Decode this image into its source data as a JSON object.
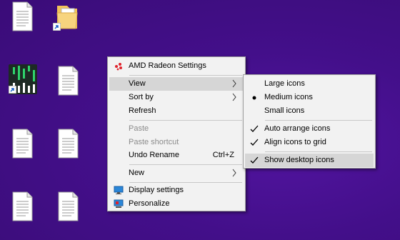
{
  "desktop": {
    "icon_names": [
      "text-file-icon",
      "folder-shortcut-icon",
      "equalizer-app-shortcut-icon",
      "shortcut-arrow-icon"
    ]
  },
  "context_menu": {
    "amd_label": "AMD Radeon Settings",
    "view_label": "View",
    "sort_by_label": "Sort by",
    "refresh_label": "Refresh",
    "paste_label": "Paste",
    "paste_shortcut_label": "Paste shortcut",
    "undo_rename_label": "Undo Rename",
    "undo_rename_shortcut": "Ctrl+Z",
    "new_label": "New",
    "display_settings_label": "Display settings",
    "personalize_label": "Personalize"
  },
  "view_submenu": {
    "large_icons_label": "Large icons",
    "medium_icons_label": "Medium icons",
    "small_icons_label": "Small icons",
    "auto_arrange_label": "Auto arrange icons",
    "align_grid_label": "Align icons to grid",
    "show_desktop_icons_label": "Show desktop icons",
    "selected_size": "Medium icons",
    "auto_arrange_checked": true,
    "align_grid_checked": true,
    "show_desktop_icons_checked": true
  },
  "colors": {
    "desktop_bg": "#3a0c78",
    "menu_bg": "#f2f2f2",
    "highlight": "#d6d6d6",
    "amd_red": "#e0232b"
  }
}
